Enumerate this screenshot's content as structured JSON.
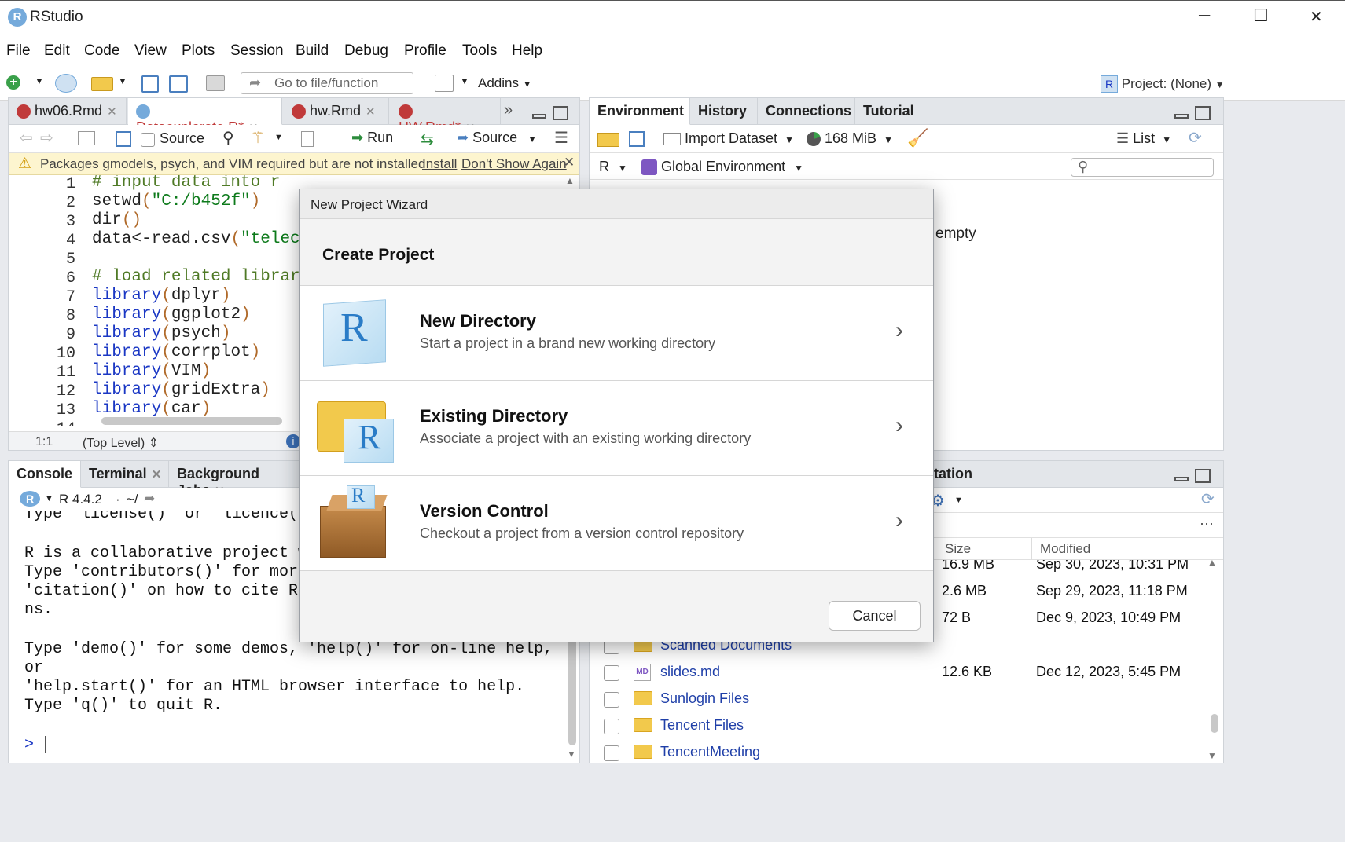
{
  "app": {
    "title": "RStudio",
    "logo_letter": "R"
  },
  "window_controls": {
    "minimize": "─",
    "maximize": "☐",
    "close": "✕"
  },
  "menu": [
    "File",
    "Edit",
    "Code",
    "View",
    "Plots",
    "Session",
    "Build",
    "Debug",
    "Profile",
    "Tools",
    "Help"
  ],
  "toolbar": {
    "goto_placeholder": "Go to file/function",
    "addins": "Addins",
    "project": "Project: (None)"
  },
  "editor": {
    "tabs": [
      "hw06.Rmd",
      "Dataexplorate.R*",
      "hw.Rmd",
      "HW.Rmd*"
    ],
    "toolbar": {
      "source_on_save": "Source",
      "run": "Run",
      "source": "Source"
    },
    "warning": {
      "text": "Packages gmodels, psych, and VIM required but are not installed.",
      "install": "Install",
      "dont_show": "Don't Show Again"
    },
    "line_numbers": [
      "1",
      "2",
      "3",
      "4",
      "5",
      "6",
      "7",
      "8",
      "9",
      "10",
      "11",
      "12",
      "13",
      "14"
    ],
    "status": {
      "position": "1:1",
      "scope": "(Top Level)"
    }
  },
  "environment": {
    "tabs": [
      "Environment",
      "History",
      "Connections",
      "Tutorial"
    ],
    "import_dataset": "Import Dataset",
    "memory": "168 MiB",
    "view_mode": "List",
    "language": "R",
    "scope": "Global Environment",
    "empty_text": "empty"
  },
  "console": {
    "tabs": [
      "Console",
      "Terminal",
      "Background Jobs"
    ],
    "version": "R 4.4.2",
    "path": "~/",
    "lines": [
      "Type 'license()' or 'licence()'",
      "",
      "R is a collaborative project w",
      "Type 'contributors()' for more",
      "'citation()' on how to cite R",
      "ns.",
      "",
      "Type 'demo()' for some demos, 'help()' for on-line help,",
      "or",
      "'help.start()' for an HTML browser interface to help.",
      "Type 'q()' to quit R.",
      "",
      ">"
    ]
  },
  "files": {
    "tab_partial": "tation",
    "columns": {
      "size": "Size",
      "modified": "Modified"
    },
    "rows": [
      {
        "name": "",
        "size": "16.9 MB",
        "modified": "Sep 30, 2023, 10:31 PM"
      },
      {
        "name": "",
        "size": "2.6 MB",
        "modified": "Sep 29, 2023, 11:18 PM"
      },
      {
        "name": "",
        "size": "72 B",
        "modified": "Dec 9, 2023, 10:49 PM"
      },
      {
        "name": "Scanned Documents",
        "size": "",
        "modified": ""
      },
      {
        "name": "slides.md",
        "size": "12.6 KB",
        "modified": "Dec 12, 2023, 5:45 PM"
      },
      {
        "name": "Sunlogin Files",
        "size": "",
        "modified": ""
      },
      {
        "name": "Tencent Files",
        "size": "",
        "modified": ""
      },
      {
        "name": "TencentMeeting",
        "size": "",
        "modified": ""
      }
    ]
  },
  "dialog": {
    "title": "New Project Wizard",
    "heading": "Create Project",
    "options": [
      {
        "title": "New Directory",
        "desc": "Start a project in a brand new working directory"
      },
      {
        "title": "Existing Directory",
        "desc": "Associate a project with an existing working directory"
      },
      {
        "title": "Version Control",
        "desc": "Checkout a project from a version control repository"
      }
    ],
    "cancel": "Cancel"
  }
}
